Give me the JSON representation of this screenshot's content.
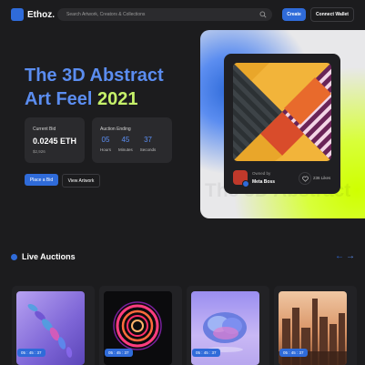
{
  "brand": {
    "name": "Ethoz."
  },
  "search": {
    "placeholder": "Search Artwork, Creators & Collections"
  },
  "nav": {
    "create_label": "Create",
    "wallet_label": "Connect Wallet"
  },
  "hero": {
    "title_line1_a": "The 3D Abstract",
    "title_line2_a": "Art Feel",
    "title_line2_b": "2021",
    "bid": {
      "label": "Current Bid",
      "value": "0.0245 ETH",
      "usd": "$2,926"
    },
    "auction": {
      "label": "Auction Ending",
      "timer": [
        {
          "value": "05",
          "unit": "Hours"
        },
        {
          "value": "45",
          "unit": "Minutes"
        },
        {
          "value": "37",
          "unit": "Seconds"
        }
      ]
    },
    "place_bid_label": "Place a Bid",
    "view_artwork_label": "View Artwork",
    "card": {
      "owned_by_label": "Owned by",
      "owner": "Meta Boss",
      "likes": "236 Likes"
    }
  },
  "live": {
    "title": "Live Auctions",
    "cards": [
      {
        "time": "05 : 45 : 37",
        "art": "purple-spiral"
      },
      {
        "time": "05 : 45 : 37",
        "art": "neon-rings"
      },
      {
        "time": "05 : 45 : 37",
        "art": "crystal-brain"
      },
      {
        "time": "05 : 45 : 37",
        "art": "city-skyline"
      }
    ]
  },
  "colors": {
    "accent": "#2f6bd9",
    "lime": "#c6f16a",
    "background": "#1c1c1e"
  }
}
